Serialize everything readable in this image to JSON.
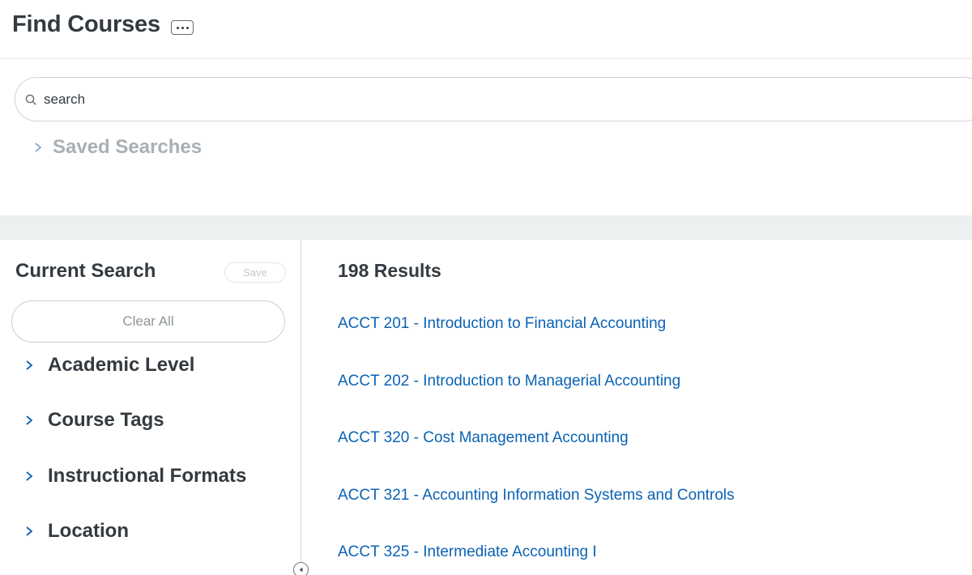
{
  "header": {
    "title": "Find Courses",
    "more_icon": "ellipsis-icon"
  },
  "search": {
    "value": "",
    "placeholder": "search",
    "icon": "search-icon"
  },
  "saved_searches": {
    "label": "Saved Searches",
    "icon": "chevron-right-icon"
  },
  "current_search": {
    "title": "Current Search",
    "save_label": "Save",
    "clear_all_label": "Clear All"
  },
  "facets": [
    {
      "label": "Academic Level"
    },
    {
      "label": "Course Tags"
    },
    {
      "label": "Instructional Formats"
    },
    {
      "label": "Location"
    }
  ],
  "results": {
    "count_label": "198 Results",
    "courses": [
      {
        "label": "ACCT 201 - Introduction to Financial Accounting"
      },
      {
        "label": "ACCT 202 - Introduction to Managerial Accounting"
      },
      {
        "label": "ACCT 320 - Cost Management Accounting"
      },
      {
        "label": "ACCT 321 - Accounting Information Systems and Controls"
      },
      {
        "label": "ACCT 325 - Intermediate Accounting I"
      }
    ]
  },
  "colors": {
    "link": "#0b62b4",
    "text": "#333a40",
    "muted": "#a8b0b5",
    "band": "#edf0f0"
  }
}
